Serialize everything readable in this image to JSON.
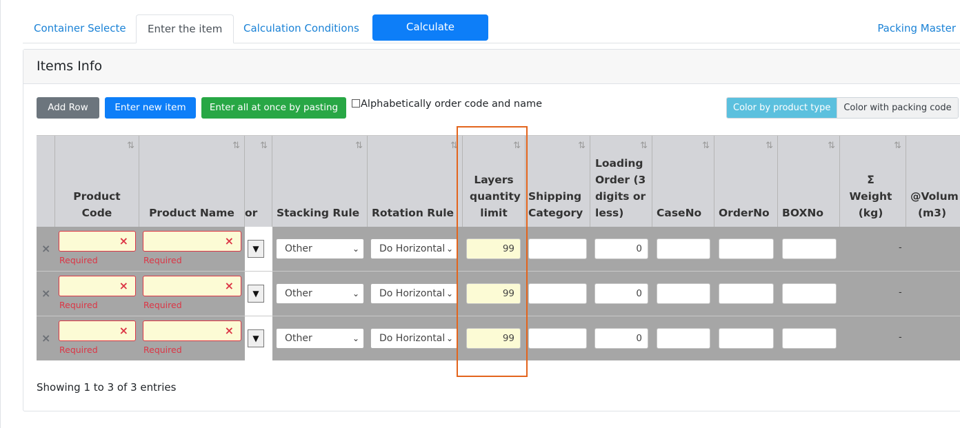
{
  "tabs": [
    {
      "label": "Container Selecte"
    },
    {
      "label": "Enter the item"
    },
    {
      "label": "Calculation Conditions"
    }
  ],
  "calculate_label": "Calculate",
  "packing_master_label": "Packing Master",
  "card": {
    "title": "Items Info"
  },
  "toolbar": {
    "add_row": "Add Row",
    "enter_new_item": "Enter new item",
    "paste_all": "Enter all at once by pasting",
    "alphabetical": "Alphabetically order code and name",
    "color_by_type": "Color by product type",
    "color_by_code": "Color with packing code"
  },
  "columns": {
    "product_code": "Product Code",
    "product_name": "Product Name",
    "color_partial": "or",
    "stacking_rule": "Stacking Rule",
    "rotation_rule": "Rotation Rule",
    "layers_limit": "Layers quantity limit",
    "shipping_category": "Shipping Category",
    "loading_order": "Loading Order (3 digits or less)",
    "case_no": "CaseNo",
    "order_no": "OrderNo",
    "box_no": "BOXNo",
    "weight": "Σ Weight (kg)",
    "volume": "@Volum (m3)"
  },
  "sort_icon": "⇅",
  "remove_icon": "×",
  "clear_icon": "×",
  "required_text": "Required",
  "rows": [
    {
      "stacking": "Other",
      "rotation": "Do Horizontal",
      "layers": "99",
      "loading_order": "0",
      "weight": "-"
    },
    {
      "stacking": "Other",
      "rotation": "Do Horizontal",
      "layers": "99",
      "loading_order": "0",
      "weight": "-"
    },
    {
      "stacking": "Other",
      "rotation": "Do Horizontal",
      "layers": "99",
      "loading_order": "0",
      "weight": "-"
    }
  ],
  "footer": {
    "info": "Showing 1 to 3 of 3 entries"
  }
}
